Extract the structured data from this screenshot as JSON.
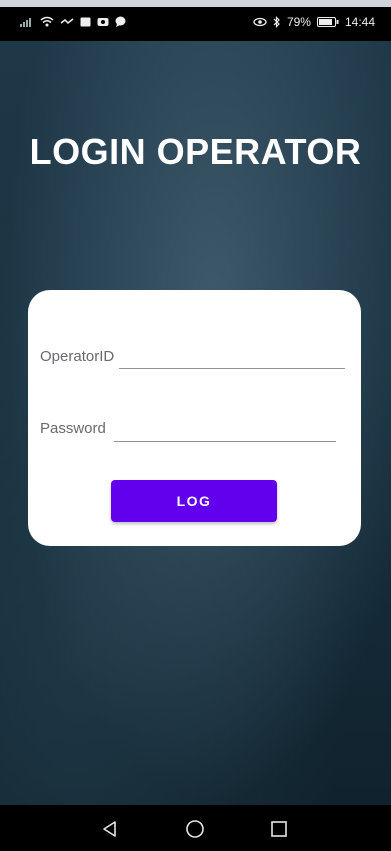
{
  "status_bar": {
    "battery": "79%",
    "time": "14:44",
    "left_icons": [
      "signal-icon",
      "wifi-icon",
      "data-icon",
      "message-icon",
      "photo-icon",
      "chat-icon"
    ],
    "right_icons": [
      "eye-comfort-icon",
      "bluetooth-icon",
      "battery-icon"
    ]
  },
  "screen": {
    "title": "LOGIN OPERATOR"
  },
  "form": {
    "operator_id_label": "OperatorID",
    "operator_id_value": "",
    "password_label": "Password",
    "password_value": "",
    "log_button": "LOG"
  },
  "nav": {
    "icons": [
      "back-icon",
      "home-icon",
      "recents-icon"
    ]
  },
  "colors": {
    "accent": "#6200ee",
    "card": "#ffffff",
    "background": "#1e3848"
  }
}
